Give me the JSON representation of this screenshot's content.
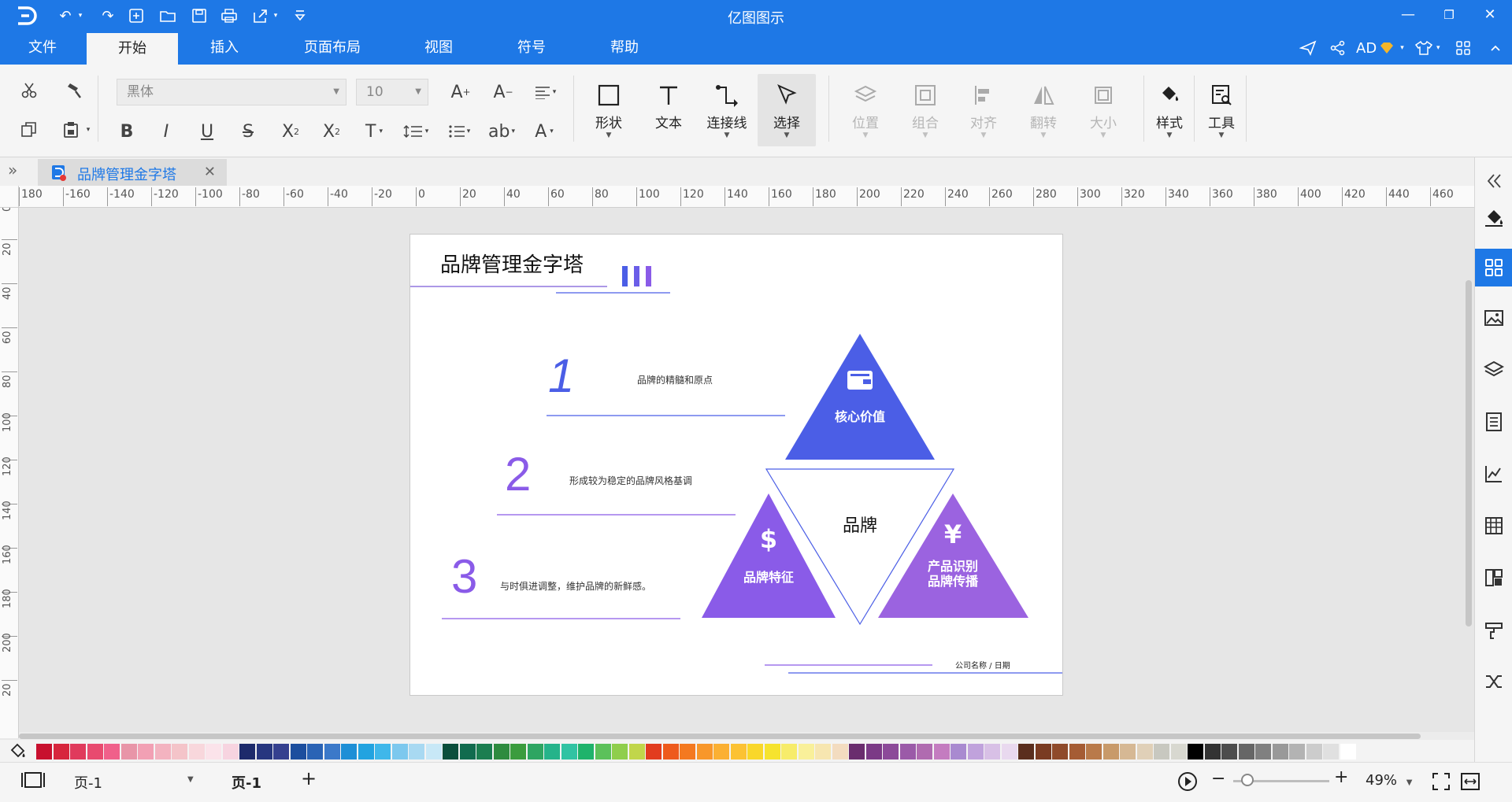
{
  "app": {
    "title": "亿图图示",
    "window_buttons": [
      "—",
      "❐",
      "✕"
    ]
  },
  "menu_tabs": [
    {
      "label": "文件"
    },
    {
      "label": "开始"
    },
    {
      "label": "插入"
    },
    {
      "label": "页面布局"
    },
    {
      "label": "视图"
    },
    {
      "label": "符号"
    },
    {
      "label": "帮助"
    }
  ],
  "account": {
    "initials": "AD"
  },
  "toolbar": {
    "font_name": "黑体",
    "font_size": "10",
    "big_buttons": [
      {
        "label": "形状"
      },
      {
        "label": "文本"
      },
      {
        "label": "连接线"
      },
      {
        "label": "选择"
      },
      {
        "label": "位置"
      },
      {
        "label": "组合"
      },
      {
        "label": "对齐"
      },
      {
        "label": "翻转"
      },
      {
        "label": "大小"
      },
      {
        "label": "样式"
      },
      {
        "label": "工具"
      }
    ]
  },
  "document": {
    "tab_title": "品牌管理金字塔",
    "close": "✕"
  },
  "ruler": {
    "h_labels": [
      "180",
      "-160",
      "-140",
      "-120",
      "-100",
      "-80",
      "-60",
      "-40",
      "-20",
      "0",
      "20",
      "40",
      "60",
      "80",
      "100",
      "120",
      "140",
      "160",
      "180",
      "200",
      "220",
      "240",
      "260",
      "280",
      "300",
      "320",
      "340",
      "360",
      "380",
      "400",
      "420",
      "440",
      "460"
    ],
    "v_labels": [
      "0",
      "20",
      "40",
      "60",
      "80",
      "100",
      "120",
      "140",
      "160",
      "180",
      "200",
      "20"
    ]
  },
  "slide": {
    "title": "品牌管理金字塔",
    "steps": [
      {
        "num": "1",
        "text": "品牌的精髓和原点"
      },
      {
        "num": "2",
        "text": "形成较为稳定的品牌风格基调"
      },
      {
        "num": "3",
        "text": "与时俱进调整，维护品牌的新鲜感。"
      }
    ],
    "triangles": {
      "top": {
        "icon": "wallet-icon",
        "label": "核心价值"
      },
      "center": {
        "label": "品牌"
      },
      "left": {
        "icon": "dollar-icon",
        "symbol": "$",
        "label": "品牌特征"
      },
      "right": {
        "icon": "yen-icon",
        "symbol": "¥",
        "label_line1": "产品识别",
        "label_line2": "品牌传播"
      }
    },
    "footer": "公司名称 / 日期",
    "colors": {
      "blue": "#4b5ee6",
      "purple": "#8a5be8",
      "violet": "#9b63e0"
    }
  },
  "palette": [
    "#c8102e",
    "#d7263d",
    "#e03a5c",
    "#e84a6f",
    "#f0608a",
    "#e895a8",
    "#f2a0b4",
    "#f3b3c0",
    "#f4c4c9",
    "#f8d7dc",
    "#fbe3ea",
    "#f7d4e0",
    "#1d2a6b",
    "#27367f",
    "#35408f",
    "#1c4e9e",
    "#2a63b5",
    "#3b79c9",
    "#1d8fd6",
    "#22a3e0",
    "#3fb7ea",
    "#7cc8ee",
    "#a8d9f2",
    "#c8e8f7",
    "#0b4f3c",
    "#116b4e",
    "#1b7e50",
    "#2e8b3f",
    "#3b9c3e",
    "#2ea562",
    "#25b38a",
    "#31c3a3",
    "#1fb36b",
    "#5cc15a",
    "#8fce4c",
    "#c1d64b",
    "#e23c1f",
    "#ee5a1c",
    "#f47920",
    "#f8972a",
    "#fbb032",
    "#fcc233",
    "#f9d72a",
    "#f6e32e",
    "#f7ec6a",
    "#f9f09a",
    "#f7e6b0",
    "#f3dcc0",
    "#6a2d6e",
    "#7b3a86",
    "#8c4a99",
    "#9b5aa8",
    "#b06bb0",
    "#c47cc0",
    "#a98ad0",
    "#c0a2dc",
    "#d8c0e6",
    "#e9d9ef",
    "#5a2e1e",
    "#7a3b22",
    "#8f4a2a",
    "#a55c34",
    "#b97a4a",
    "#c89a6a",
    "#d6b894",
    "#e0d0b8",
    "#c8c8c0",
    "#d8d8d0",
    "#000000",
    "#333333",
    "#4d4d4d",
    "#666666",
    "#808080",
    "#999999",
    "#b3b3b3",
    "#cccccc",
    "#e0e0e0",
    "#ffffff"
  ],
  "statusbar": {
    "page_select": "页-1",
    "page_tab": "页-1",
    "add": "+",
    "zoom": "49%"
  }
}
